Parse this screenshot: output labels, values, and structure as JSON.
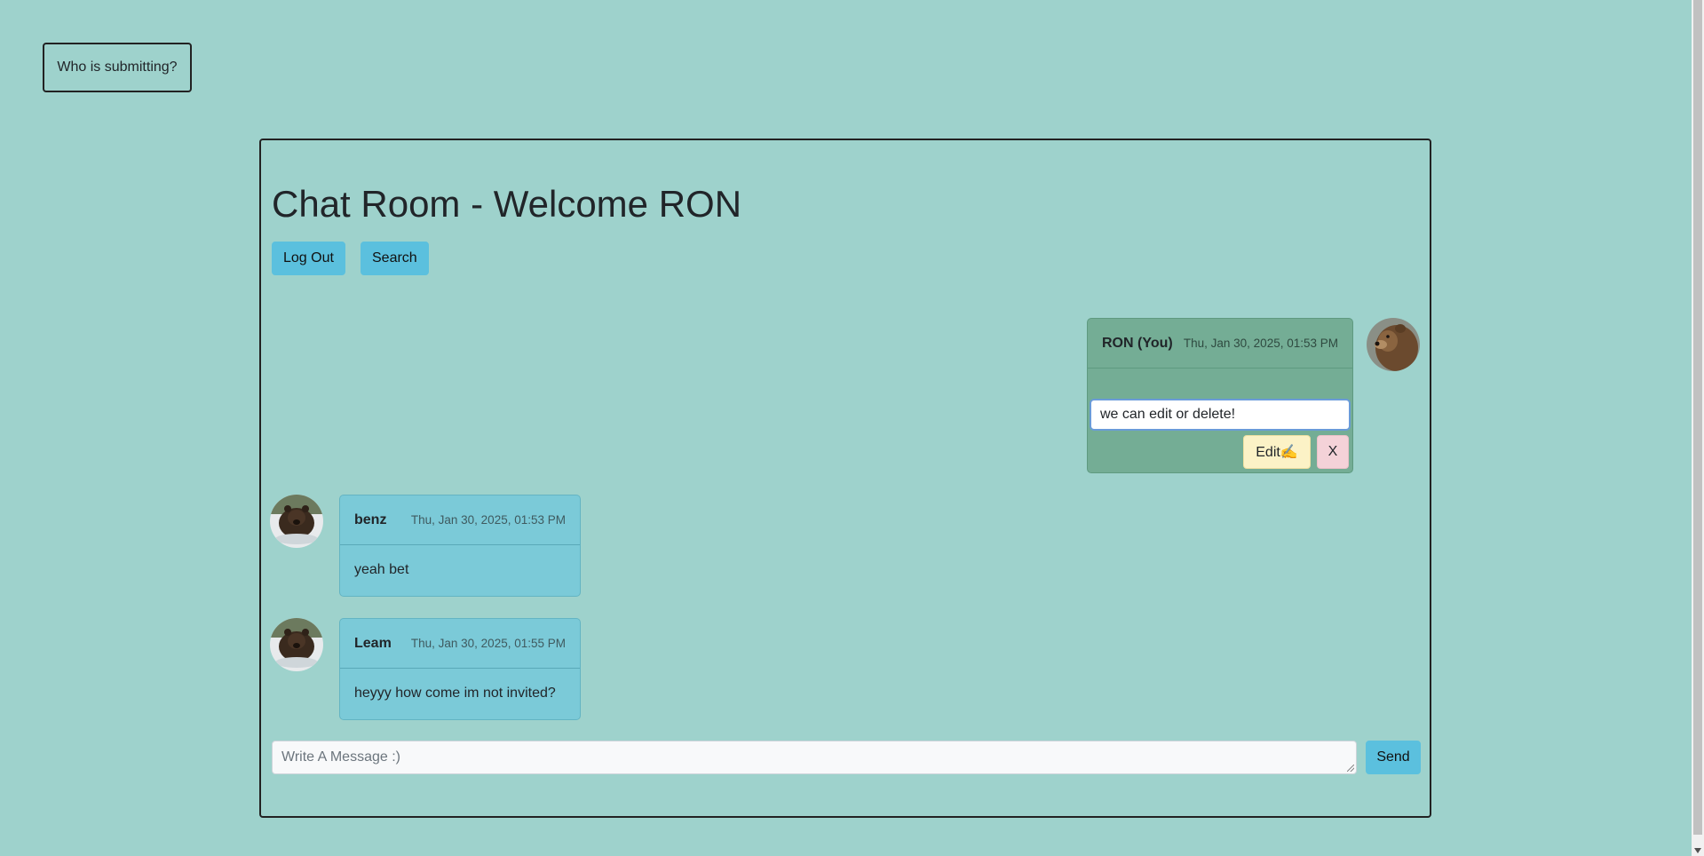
{
  "submitter_button": "Who is submitting?",
  "room": {
    "title": "Chat Room - Welcome RON",
    "logout_label": "Log Out",
    "search_label": "Search"
  },
  "messages": [
    {
      "author": "RON (You)",
      "time": "Thu, Jan 30, 2025, 01:53 PM",
      "edit_value": "we can edit or delete!",
      "edit_label": "Edit✍️",
      "delete_label": "X",
      "own": true
    },
    {
      "author": "benz",
      "time": "Thu, Jan 30, 2025, 01:53 PM",
      "text": "yeah bet",
      "own": false
    },
    {
      "author": "Leam",
      "time": "Thu, Jan 30, 2025, 01:55 PM",
      "text": "heyyy how come im not invited?",
      "own": false
    }
  ],
  "composer": {
    "placeholder": "Write A Message :)",
    "send_label": "Send"
  },
  "colors": {
    "page_bg": "#9ed2cc",
    "own_message_bg": "#74ad95",
    "other_message_bg": "#7bcad8",
    "accent_button": "#5bc0de"
  },
  "icons": {
    "avatar_self": "bear-avatar-icon",
    "avatar_other": "bear-avatar-icon"
  }
}
